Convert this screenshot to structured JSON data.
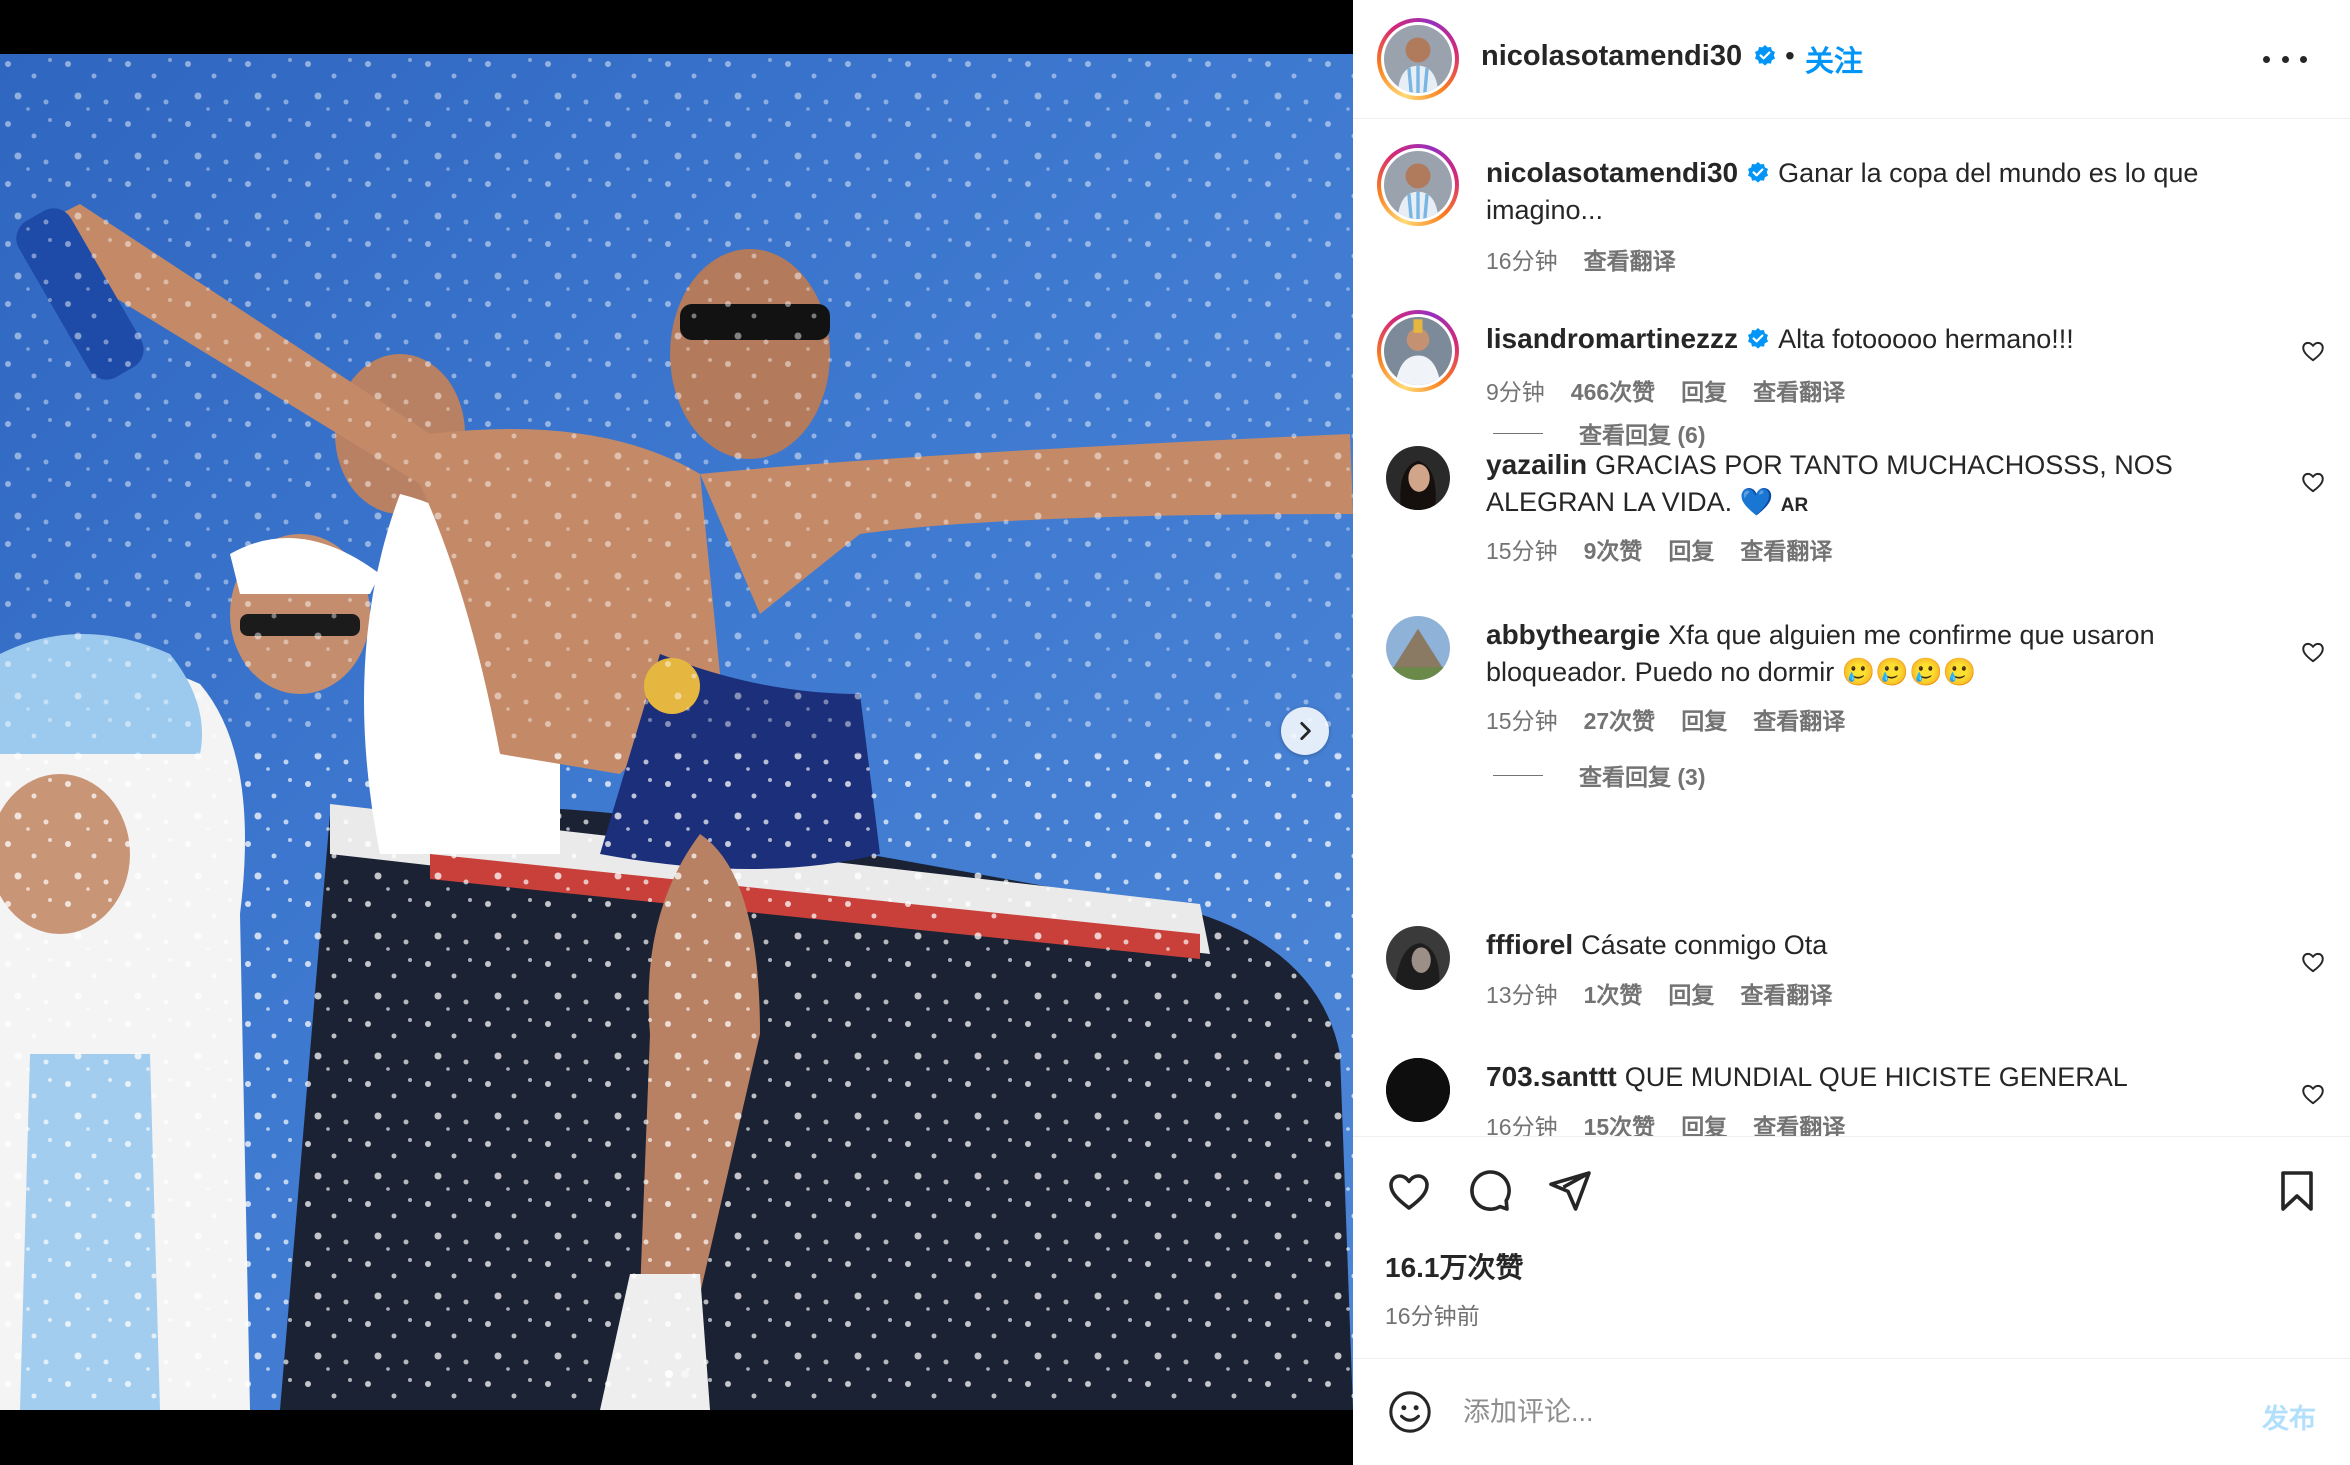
{
  "post": {
    "author": "nicolasotamendi30",
    "separator": "•",
    "follow_label": "关注",
    "more_label": "更多选项",
    "caption": {
      "username": "nicolasotamendi30",
      "text": "Ganar la copa del mundo es lo que imagino...",
      "time": "16分钟",
      "translate": "查看翻译"
    },
    "likes": "16.1万次赞",
    "time_ago": "16分钟前"
  },
  "comments": [
    {
      "username": "lisandromartinezzz",
      "verified": true,
      "text": "Alta fotooooo hermano!!!",
      "time": "9分钟",
      "likes": "466次赞",
      "reply": "回复",
      "translate": "查看翻译",
      "view_replies": "查看回复 (6)"
    },
    {
      "username": "yazailin",
      "verified": false,
      "text": "GRACIAS POR TANTO MUCHACHOSSS, NOS ALEGRAN LA VIDA.",
      "emoji": "💙",
      "flag_text": "AR",
      "time": "15分钟",
      "likes": "9次赞",
      "reply": "回复",
      "translate": "查看翻译"
    },
    {
      "username": "abbytheargie",
      "verified": false,
      "text": "Xfa que alguien me confirme que usaron bloqueador. Puedo no dormir 🥲🥲🥲🥲",
      "time": "15分钟",
      "likes": "27次赞",
      "reply": "回复",
      "translate": "查看翻译",
      "view_replies": "查看回复 (3)"
    },
    {
      "username": "fffiorel",
      "verified": false,
      "text": "Cásate conmigo Ota",
      "time": "13分钟",
      "likes": "1次赞",
      "reply": "回复",
      "translate": "查看翻译"
    },
    {
      "username": "703.santtt",
      "verified": false,
      "text": "QUE MUNDIAL QUE HICISTE GENERAL",
      "time": "16分钟",
      "likes": "15次赞",
      "reply": "回复",
      "translate": "查看翻译"
    }
  ],
  "composer": {
    "placeholder": "添加评论...",
    "post_label": "发布"
  },
  "colors": {
    "accent": "#0095f6",
    "verified": "#0095f6",
    "post_disabled": "#b2dffc",
    "sky": "#3b73c9"
  },
  "icons": {
    "like": "heart-icon",
    "comment": "comment-icon",
    "share": "paper-plane-icon",
    "save": "bookmark-icon",
    "emoji": "smiley-icon",
    "next": "chevron-right-icon",
    "more": "ellipsis-icon"
  }
}
